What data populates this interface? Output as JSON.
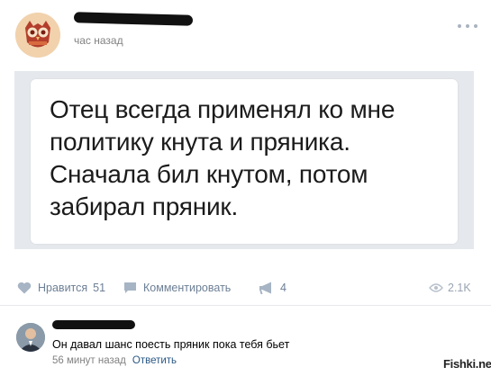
{
  "post": {
    "timestamp": "час назад",
    "quote": "Отец всегда применял ко мне политику кнута и пряника. Сначала бил кнутом, потом забирал пряник.",
    "colors": {
      "image_frame": "#e5e8ec",
      "action_text": "#6c7f95",
      "link": "#2a5885"
    }
  },
  "actions": {
    "like_label": "Нравится",
    "like_count": "51",
    "comment_label": "Комментировать",
    "share_count": "4",
    "views_count": "2.1K",
    "icons": [
      "heart-icon",
      "comment-icon",
      "megaphone-icon",
      "eye-icon",
      "more-dots-icon"
    ]
  },
  "comment": {
    "text": "Он давал шанс поесть пряник пока тебя бьет",
    "time": "56 минут назад",
    "reply_label": "Ответить"
  },
  "watermark": "Fishki.net"
}
